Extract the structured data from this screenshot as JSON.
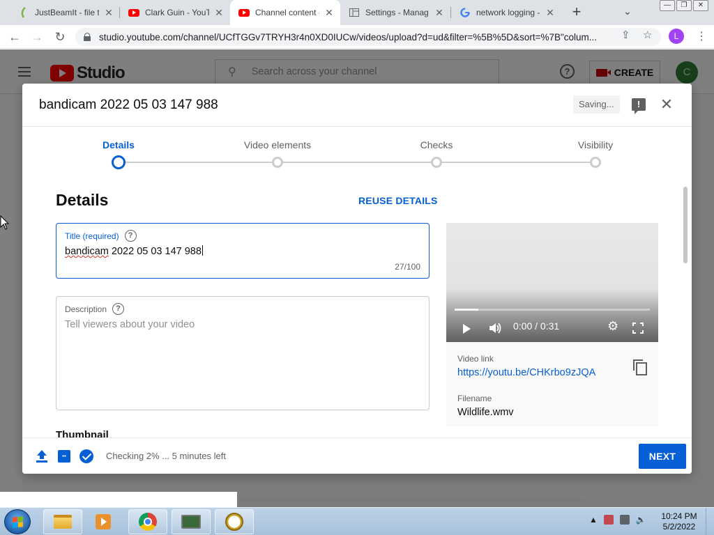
{
  "browser": {
    "tabs": [
      {
        "title": "JustBeamIt - file tr",
        "icon": "justbeamit-favicon",
        "active": false
      },
      {
        "title": "Clark Guin - YouTu",
        "icon": "youtube-favicon",
        "active": false
      },
      {
        "title": "Channel content -",
        "icon": "youtube-favicon",
        "active": true
      },
      {
        "title": "Settings - Manag",
        "icon": "settings-favicon",
        "active": false
      },
      {
        "title": "network logging -",
        "icon": "google-favicon",
        "active": false
      }
    ],
    "url": "studio.youtube.com/channel/UCfTGGv7TRYH3r4n0XD0IUCw/videos/upload?d=ud&filter=%5B%5D&sort=%7B\"colum...",
    "profile_initial": "L"
  },
  "studio": {
    "logo_text": "Studio",
    "search_placeholder": "Search across your channel",
    "create_label": "CREATE",
    "avatar_initial": "C"
  },
  "dialog": {
    "title": "bandicam 2022 05 03 147 988",
    "saving_label": "Saving...",
    "steps": [
      {
        "label": "Details",
        "active": true
      },
      {
        "label": "Video elements",
        "active": false
      },
      {
        "label": "Checks",
        "active": false
      },
      {
        "label": "Visibility",
        "active": false
      }
    ],
    "section_title": "Details",
    "reuse_label": "REUSE DETAILS",
    "title_field": {
      "label": "Title (required)",
      "value_underlined": "bandicam",
      "value_rest": " 2022 05 03 147 988",
      "count": "27/100"
    },
    "description_field": {
      "label": "Description",
      "placeholder": "Tell viewers about your video"
    },
    "thumbnail_title": "Thumbnail",
    "player": {
      "time": "0:00 / 0:31",
      "progress": 0.12
    },
    "video_link_label": "Video link",
    "video_link": "https://youtu.be/CHKrbo9zJQA",
    "filename_label": "Filename",
    "filename": "Wildlife.wmv",
    "status_text": "Checking 2% ... 5 minutes left",
    "next_label": "NEXT"
  },
  "taskbar": {
    "time": "10:24 PM",
    "date": "5/2/2022"
  },
  "colors": {
    "accent_blue": "#065fd4",
    "youtube_red": "#ff0000"
  }
}
